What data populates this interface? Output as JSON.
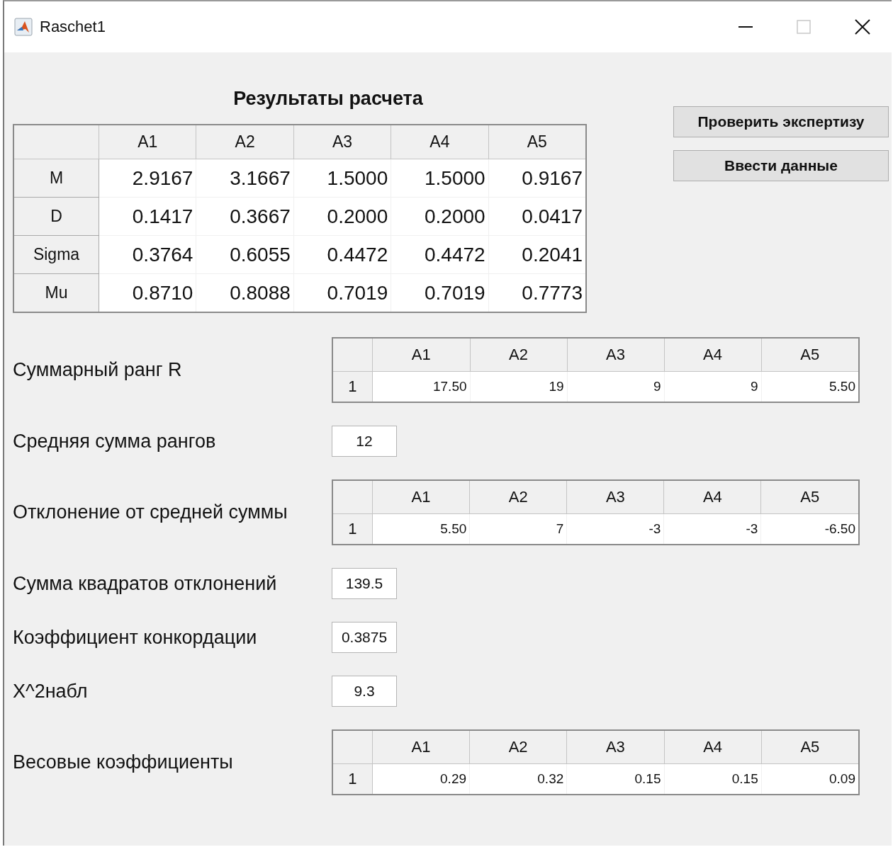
{
  "window": {
    "title": "Raschet1"
  },
  "results": {
    "title": "Результаты расчета",
    "columns": [
      "A1",
      "A2",
      "A3",
      "A4",
      "A5"
    ],
    "rows": [
      {
        "header": "M",
        "values": [
          "2.9167",
          "3.1667",
          "1.5000",
          "1.5000",
          "0.9167"
        ]
      },
      {
        "header": "D",
        "values": [
          "0.1417",
          "0.3667",
          "0.2000",
          "0.2000",
          "0.0417"
        ]
      },
      {
        "header": "Sigma",
        "values": [
          "0.3764",
          "0.6055",
          "0.4472",
          "0.4472",
          "0.2041"
        ]
      },
      {
        "header": "Mu",
        "values": [
          "0.8710",
          "0.8088",
          "0.7019",
          "0.7019",
          "0.7773"
        ]
      }
    ]
  },
  "buttons": [
    "Проверить экспертизу",
    "Ввести данные"
  ],
  "items": [
    {
      "kind": "table",
      "label": "Суммарный ранг R",
      "columns": [
        "A1",
        "A2",
        "A3",
        "A4",
        "A5"
      ],
      "row_header": "1",
      "values": [
        "17.50",
        "19",
        "9",
        "9",
        "5.50"
      ]
    },
    {
      "kind": "field",
      "label": "Средняя сумма рангов",
      "value": "12"
    },
    {
      "kind": "table",
      "label": "Отклонение от средней суммы",
      "columns": [
        "A1",
        "A2",
        "A3",
        "A4",
        "A5"
      ],
      "row_header": "1",
      "values": [
        "5.50",
        "7",
        "-3",
        "-3",
        "-6.50"
      ]
    },
    {
      "kind": "field",
      "label": "Сумма квадратов отклонений",
      "value": "139.5"
    },
    {
      "kind": "field",
      "label": "Коэффициент конкордации",
      "value": "0.3875"
    },
    {
      "kind": "field",
      "label": "X^2набл",
      "value": "9.3"
    },
    {
      "kind": "table",
      "label": "Весовые коэффициенты",
      "columns": [
        "A1",
        "A2",
        "A3",
        "A4",
        "A5"
      ],
      "row_header": "1",
      "values": [
        "0.29",
        "0.32",
        "0.15",
        "0.15",
        "0.09"
      ]
    }
  ]
}
